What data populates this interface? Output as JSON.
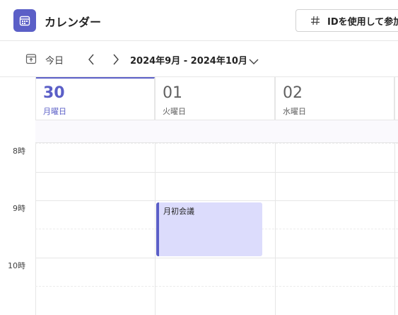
{
  "header": {
    "title": "カレンダー",
    "join_button_label": "IDを使用して参加"
  },
  "toolbar": {
    "today_label": "今日",
    "date_range": "2024年9月 - 2024年10月"
  },
  "days": [
    {
      "number": "30",
      "weekday": "月曜日",
      "selected": true
    },
    {
      "number": "01",
      "weekday": "火曜日",
      "selected": false
    },
    {
      "number": "02",
      "weekday": "水曜日",
      "selected": false
    }
  ],
  "hours": [
    "8時",
    "9時",
    "10時"
  ],
  "events": [
    {
      "title": "月初会議"
    }
  ],
  "colors": {
    "accent": "#5b5fc7",
    "event_bg": "#dcdcfc"
  }
}
